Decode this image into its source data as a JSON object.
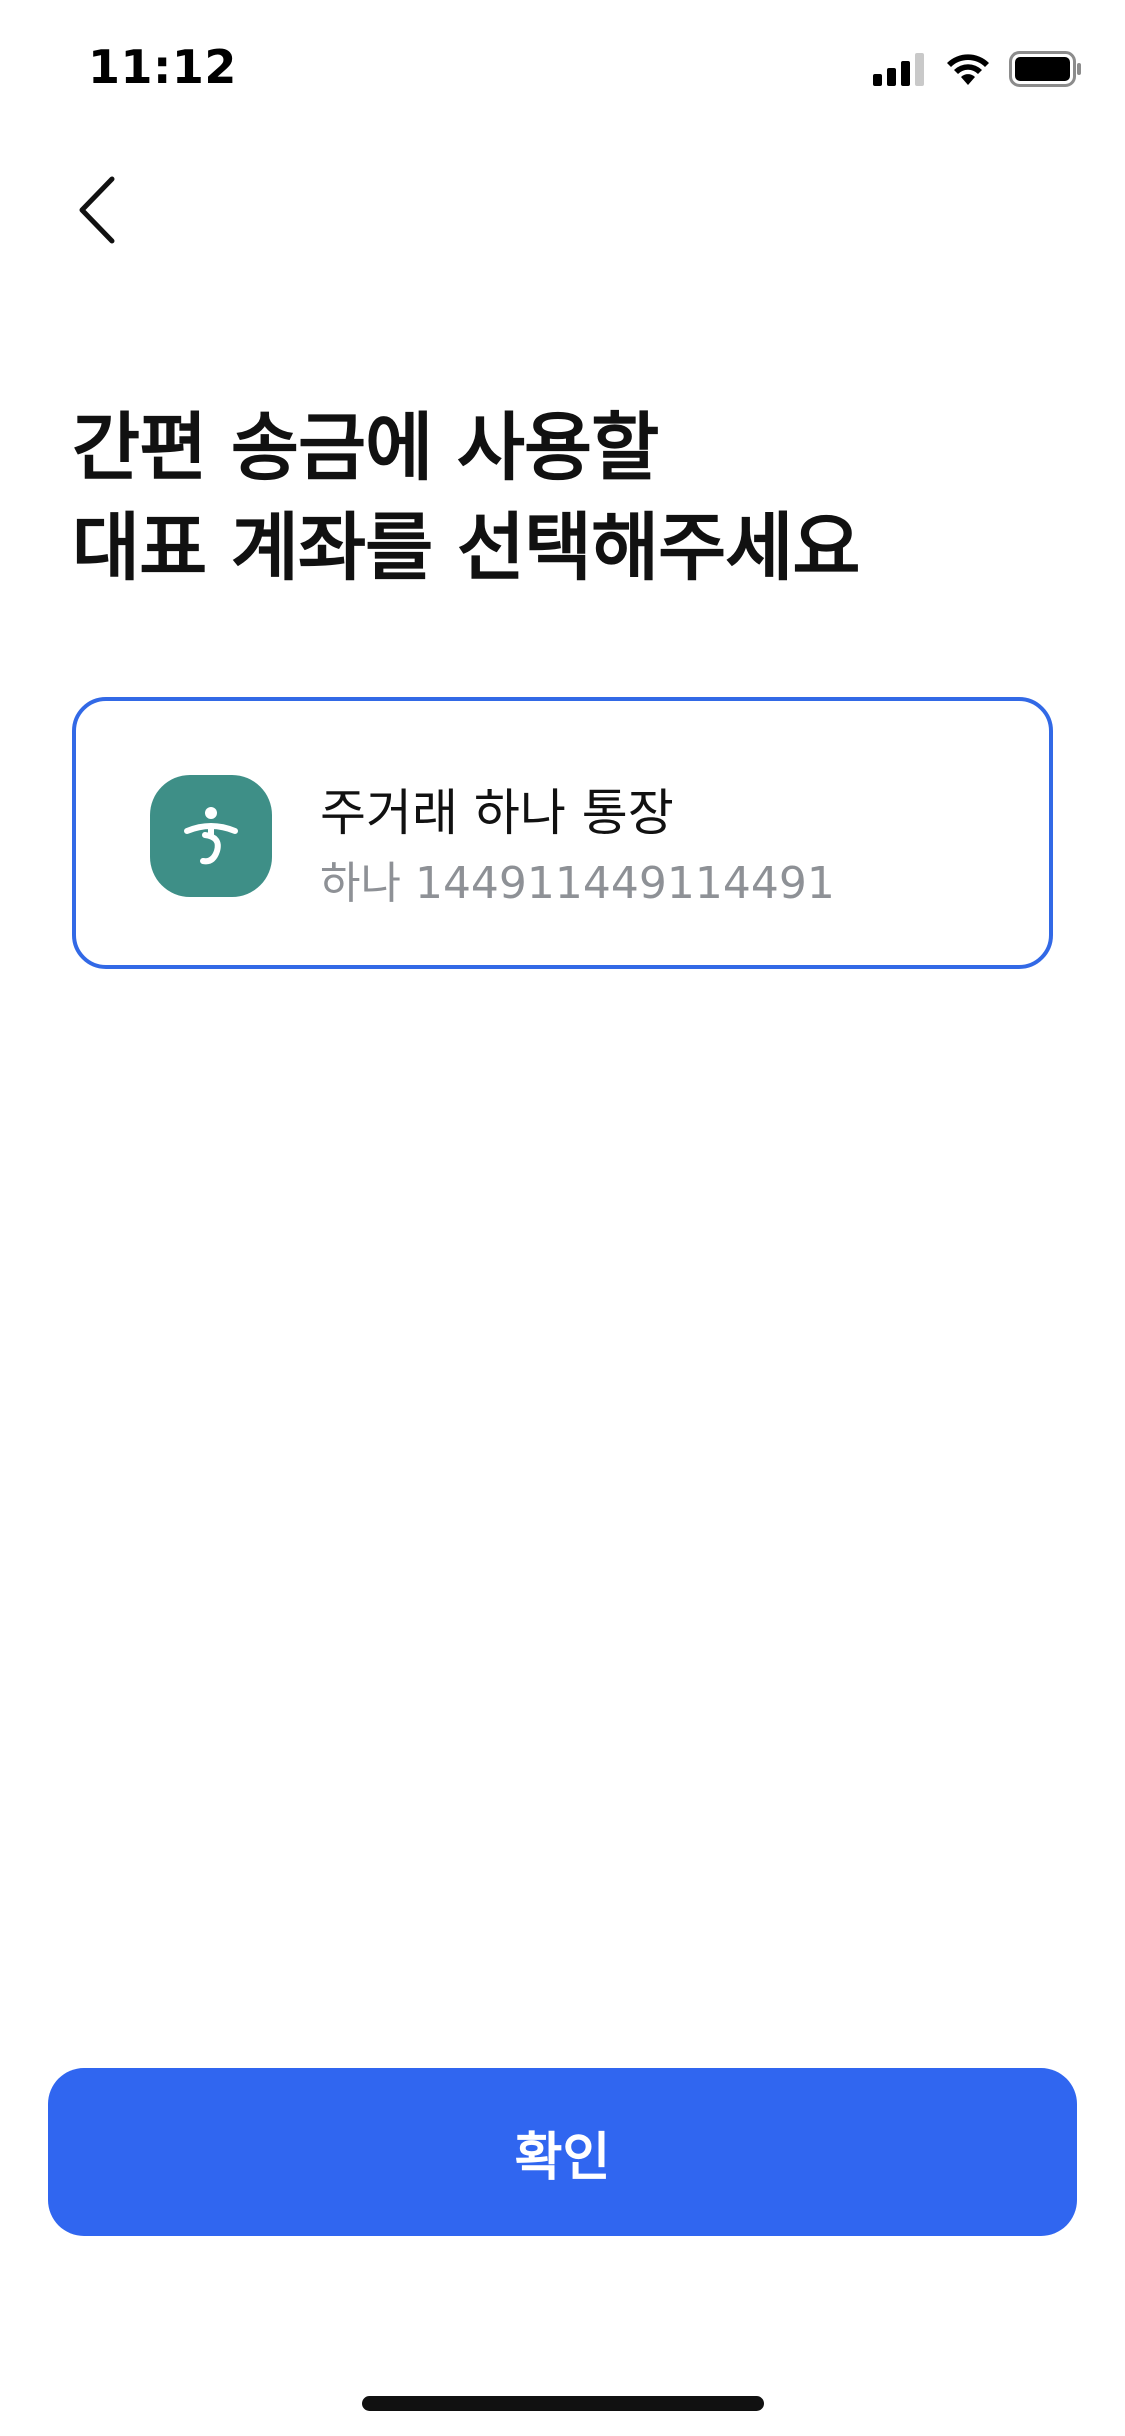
{
  "status_bar": {
    "time": "11:12",
    "icons": [
      "signal-icon",
      "wifi-icon",
      "battery-icon"
    ]
  },
  "header": {
    "back_icon": "chevron-left-icon"
  },
  "title": {
    "line1": "간편 송금에 사용할",
    "line2": "대표 계좌를 선택해주세요"
  },
  "account": {
    "name": "주거래 하나 통장",
    "number": "하나 144911449114491",
    "logo_icon": "hana-bank-logo-icon",
    "logo_color": "#3e8f87",
    "selected": true,
    "selected_border_color": "#3269e6"
  },
  "footer": {
    "confirm_label": "확인",
    "confirm_color": "#3066f0"
  }
}
